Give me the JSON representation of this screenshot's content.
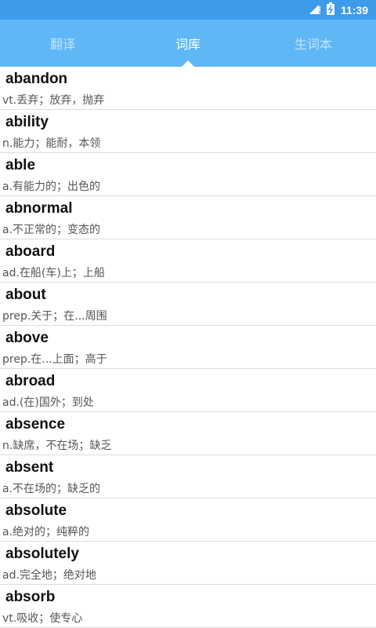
{
  "status_bar": {
    "time": "11:39",
    "signal_icon": "signal-icon",
    "battery_icon": "battery-icon"
  },
  "tabs": [
    {
      "label": "翻译",
      "active": false
    },
    {
      "label": "词库",
      "active": true
    },
    {
      "label": "生词本",
      "active": false
    }
  ],
  "words": [
    {
      "term": "abandon",
      "definition": "vt.丢弃；放弃，抛弃"
    },
    {
      "term": "ability",
      "definition": "n.能力；能耐，本领"
    },
    {
      "term": "able",
      "definition": "a.有能力的；出色的"
    },
    {
      "term": "abnormal",
      "definition": "a.不正常的；变态的"
    },
    {
      "term": "aboard",
      "definition": "ad.在船(车)上；上船"
    },
    {
      "term": "about",
      "definition": "prep.关于；在...周围"
    },
    {
      "term": "above",
      "definition": "prep.在...上面；高于"
    },
    {
      "term": "abroad",
      "definition": "ad.(在)国外；到处"
    },
    {
      "term": "absence",
      "definition": "n.缺席，不在场；缺乏"
    },
    {
      "term": "absent",
      "definition": "a.不在场的；缺乏的"
    },
    {
      "term": "absolute",
      "definition": "a.绝对的；纯粹的"
    },
    {
      "term": "absolutely",
      "definition": "ad.完全地；绝对地"
    },
    {
      "term": "absorb",
      "definition": "vt.吸收；使专心"
    }
  ],
  "colors": {
    "status_bar": "#3d9be9",
    "tab_bar": "#5fb7f6",
    "tab_inactive": "#c6e4fb",
    "tab_active": "#ffffff"
  }
}
